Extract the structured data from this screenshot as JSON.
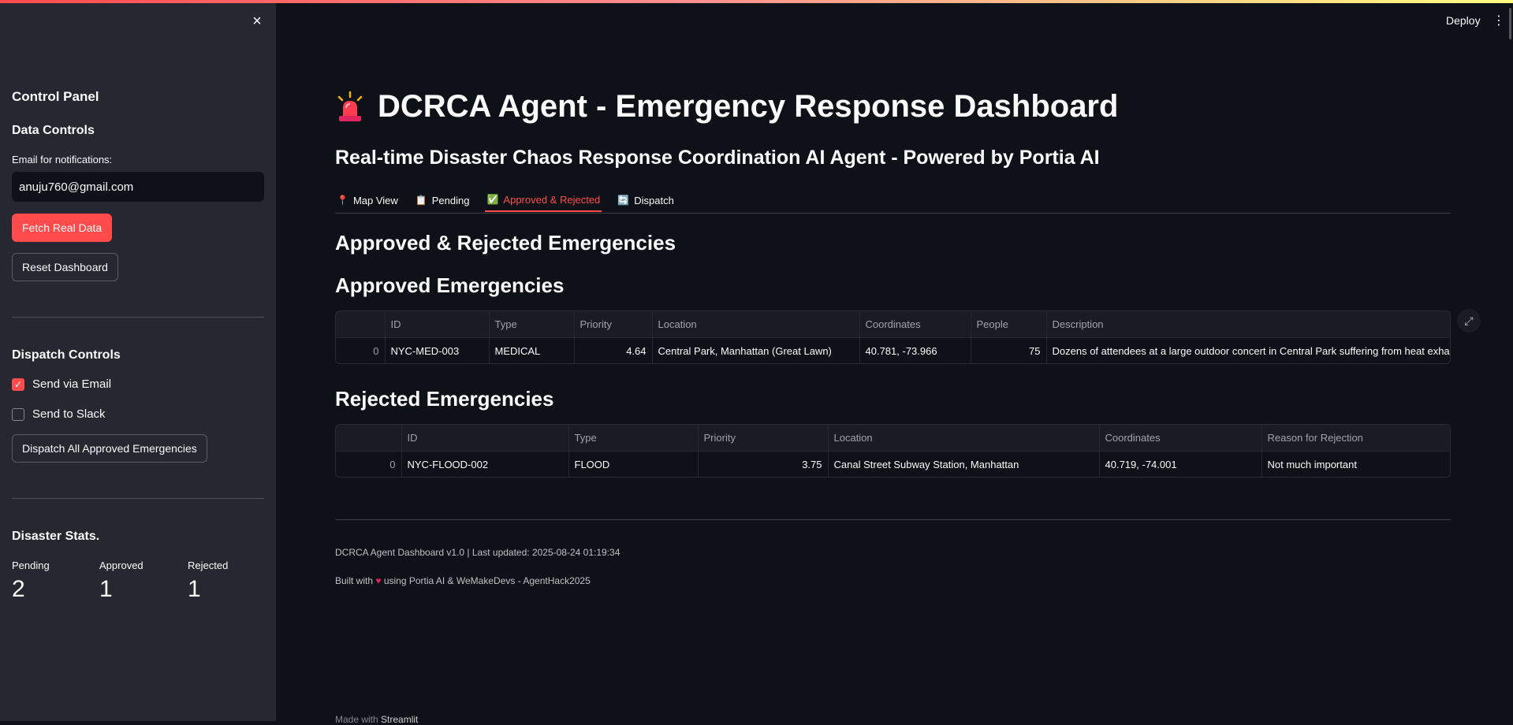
{
  "sidebar": {
    "close_icon": "×",
    "control_panel": "Control Panel",
    "data_controls": "Data Controls",
    "email_label": "Email for notifications:",
    "email_value": "anuju760@gmail.com",
    "fetch_button": "Fetch Real Data",
    "reset_button": "Reset Dashboard",
    "dispatch_controls": "Dispatch Controls",
    "send_email_label": "Send via Email",
    "send_email_checked": true,
    "send_slack_label": "Send to Slack",
    "send_slack_checked": false,
    "dispatch_button": "Dispatch All Approved Emergencies",
    "stats_title": "Disaster Stats.",
    "stats": [
      {
        "label": "Pending",
        "value": "2"
      },
      {
        "label": "Approved",
        "value": "1"
      },
      {
        "label": "Rejected",
        "value": "1"
      }
    ]
  },
  "header": {
    "deploy": "Deploy",
    "menu_icon": "⋮"
  },
  "main": {
    "title": "DCRCA Agent - Emergency Response Dashboard",
    "title_icon": "siren-icon",
    "subtitle": "Real-time Disaster Chaos Response Coordination AI Agent - Powered by Portia AI",
    "tabs": [
      {
        "icon": "📍",
        "label": "Map View",
        "active": false
      },
      {
        "icon": "📋",
        "label": "Pending",
        "active": false
      },
      {
        "icon": "✅",
        "label": "Approved & Rejected",
        "active": true
      },
      {
        "icon": "🔄",
        "label": "Dispatch",
        "active": false
      }
    ],
    "section_title": "Approved & Rejected Emergencies",
    "approved_title": "Approved Emergencies",
    "approved_table": {
      "columns": [
        "",
        "ID",
        "Type",
        "Priority",
        "Location",
        "Coordinates",
        "People",
        "Description"
      ],
      "rows": [
        [
          "0",
          "NYC-MED-003",
          "MEDICAL",
          "4.64",
          "Central Park, Manhattan (Great Lawn)",
          "40.781, -73.966",
          "75",
          "Dozens of attendees at a large outdoor concert in Central Park suffering from heat exhaustion"
        ]
      ]
    },
    "rejected_title": "Rejected Emergencies",
    "rejected_table": {
      "columns": [
        "",
        "ID",
        "Type",
        "Priority",
        "Location",
        "Coordinates",
        "Reason for Rejection"
      ],
      "rows": [
        [
          "0",
          "NYC-FLOOD-002",
          "FLOOD",
          "3.75",
          "Canal Street Subway Station, Manhattan",
          "40.719, -74.001",
          "Not much important"
        ]
      ]
    },
    "footer_version": "DCRCA Agent Dashboard v1.0 | Last updated: 2025-08-24 01:19:34",
    "footer_built_prefix": "Built with",
    "footer_built_suffix": "using Portia AI & WeMakeDevs - AgentHack2025",
    "made_with_prefix": "Made with",
    "made_with_brand": "Streamlit"
  },
  "colors": {
    "accent": "#ff4b4b",
    "background": "#0e1117",
    "sidebar": "#262730"
  }
}
